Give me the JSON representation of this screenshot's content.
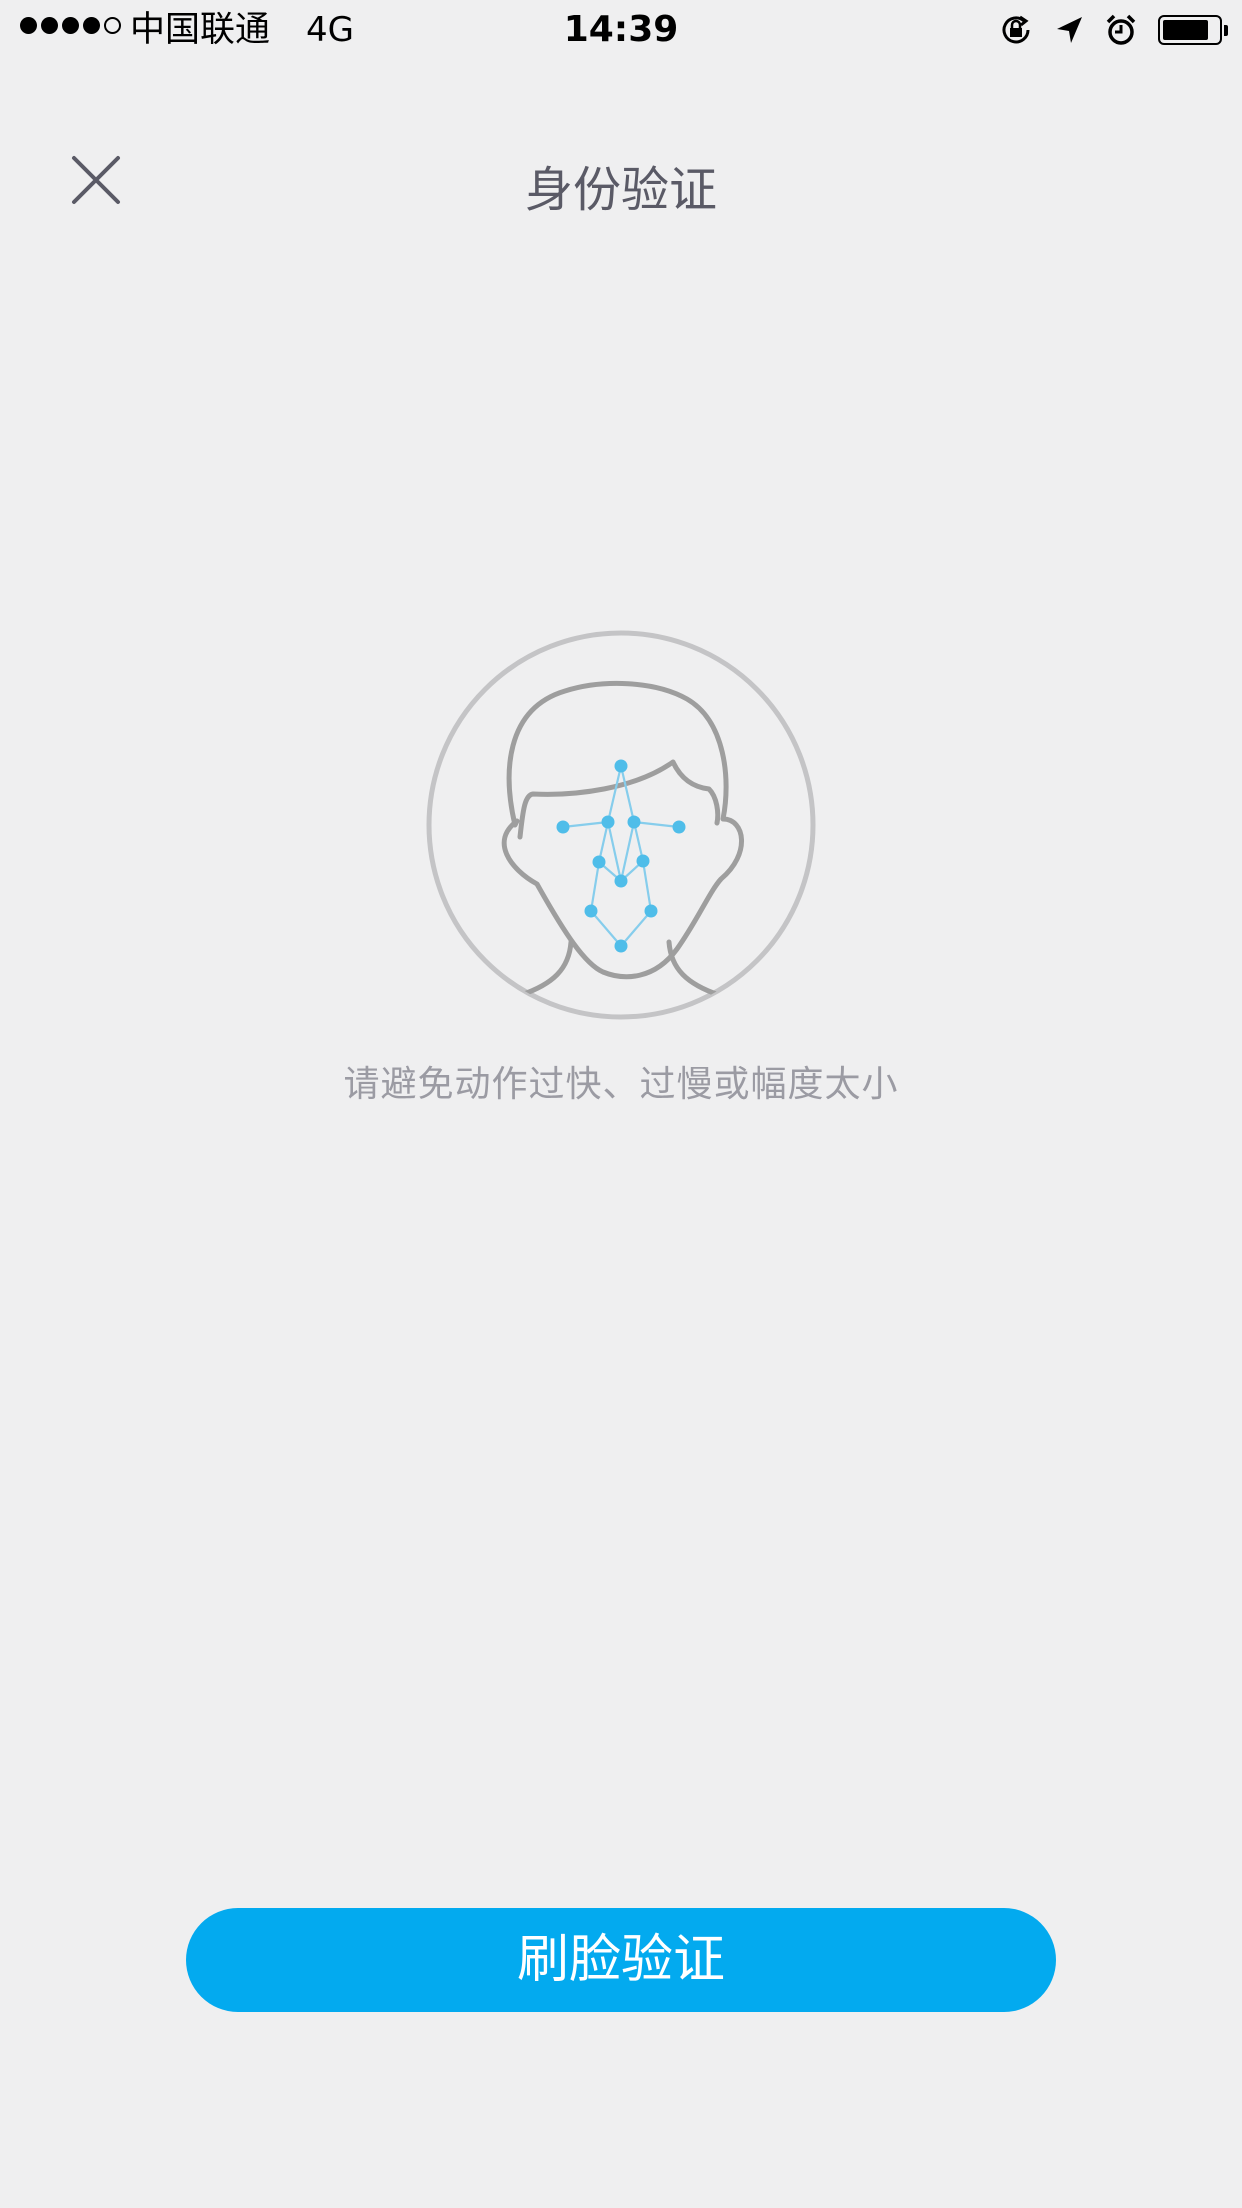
{
  "status_bar": {
    "carrier": "中国联通",
    "network": "4G",
    "time": "14:39",
    "signal_bars_filled": 4,
    "signal_bars_total": 5,
    "battery_level": 0.84,
    "icons": [
      "orientation-lock-icon",
      "location-arrow-icon",
      "alarm-icon",
      "battery-icon"
    ]
  },
  "header": {
    "close_icon": "close-icon",
    "title": "身份验证"
  },
  "main": {
    "illustration": "face-scan-icon",
    "hint": "请避免动作过快、过慢或幅度太小"
  },
  "footer": {
    "verify_button_label": "刷脸验证"
  },
  "colors": {
    "background": "#efeff0",
    "accent": "#03aaef",
    "title": "#5a5a66",
    "hint": "#9b9ba3",
    "face_outline": "#9e9e9e",
    "face_points": "#4fbde9"
  }
}
